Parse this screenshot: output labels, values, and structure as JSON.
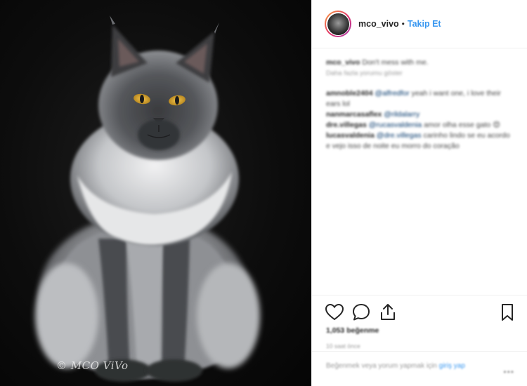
{
  "post": {
    "photo": {
      "watermark": "© MCO ViVo"
    },
    "header": {
      "username": "mco_vivo",
      "separator": "•",
      "follow_label": "Takip Et"
    },
    "caption": {
      "username": "mco_vivo",
      "text": "Don't mess with me.",
      "meta": "Daha fazla yorumu göster"
    },
    "comments": [
      {
        "username": "amnoble2404",
        "mention": "@alfredfor",
        "text": " yeah i want one, i love their ears lol"
      },
      {
        "username": "nanmarcasaflex",
        "mention": "@rildalarry",
        "text": ""
      },
      {
        "username": "dre.villegas",
        "mention": "@rucasvaldenia",
        "text": " amor olha esse gato 😍"
      },
      {
        "username": "lucasvaldenia",
        "mention": "@dre.villegas",
        "text": " carinho lindo se eu acordo e vejo isso de noite eu morro do coração"
      }
    ],
    "likes": "1,053 beğenme",
    "time": "10 saat önce",
    "comment_placeholder": "Beğenmek veya yorum yapmak için",
    "comment_login_link": "giriş yap",
    "more_label": "•••",
    "icons": {
      "like": "heart-icon",
      "comment": "comment-icon",
      "share": "share-icon",
      "save": "bookmark-icon"
    },
    "colors": {
      "follow": "#3897f0",
      "text": "#262626",
      "border": "#efefef",
      "photo_bg": "#0d0d0d"
    }
  }
}
